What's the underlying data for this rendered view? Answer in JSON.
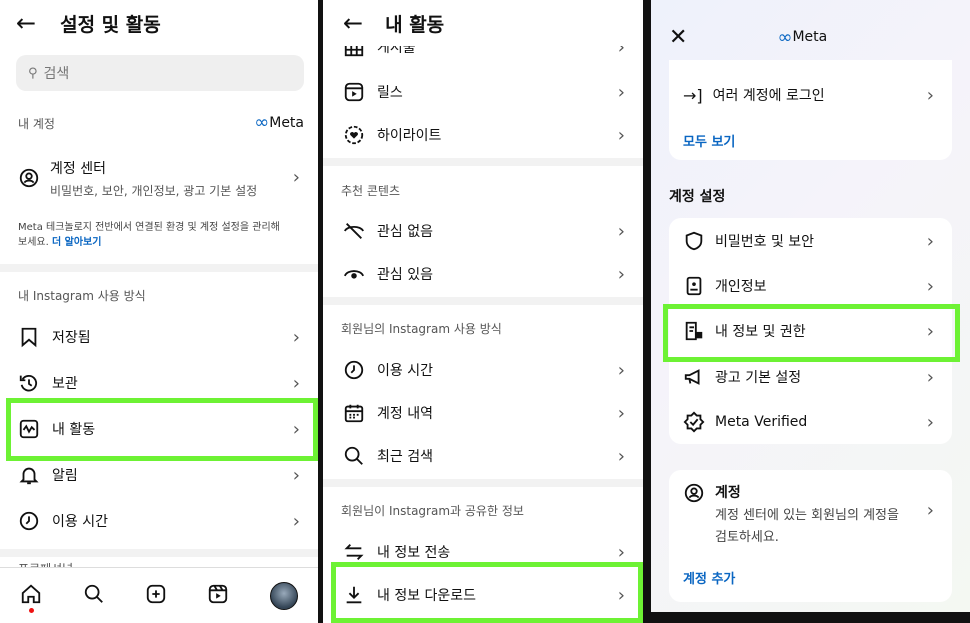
{
  "p1": {
    "title": "설정 및 활동",
    "search_placeholder": "검색",
    "my_account": "내 계정",
    "meta": "Meta",
    "account_center": {
      "title": "계정 센터",
      "subtitle": "비밀번호, 보안, 개인정보, 광고 기본 설정"
    },
    "meta_desc": "Meta 테크놀로지 전반에서 연결된 환경 및 계정 설정을 관리해보세요.",
    "learn_more": "더 알아보기",
    "usage_section": "내 Instagram 사용 방식",
    "items": [
      "저장됨",
      "보관",
      "내 활동",
      "알림",
      "이용 시간"
    ],
    "cut_section": "프로페셔널"
  },
  "p2": {
    "title": "내 활동",
    "top_items": [
      "게시물",
      "릴스",
      "하이라이트"
    ],
    "rec_section": "추천 콘텐츠",
    "rec_items": [
      "관심 없음",
      "관심 있음"
    ],
    "usage_section": "회원님의 Instagram 사용 방식",
    "usage_items": [
      "이용 시간",
      "계정 내역",
      "최근 검색"
    ],
    "shared_section": "회원님이 Instagram과 공유한 정보",
    "shared_items": [
      "내 정보 전송",
      "내 정보 다운로드"
    ]
  },
  "p3": {
    "meta": "Meta",
    "login_multi": "여러 계정에 로그인",
    "see_all": "모두 보기",
    "settings_section": "계정 설정",
    "settings_items": [
      "비밀번호 및 보안",
      "개인정보",
      "내 정보 및 권한",
      "광고 기본 설정",
      "Meta Verified"
    ],
    "account_title": "계정",
    "account_desc1": "계정 센터에 있는 회원님의 계정을",
    "account_desc2": "검토하세요.",
    "add_account": "계정 추가"
  },
  "colors": {
    "highlight": "#6df234",
    "link": "#0a66c2"
  }
}
